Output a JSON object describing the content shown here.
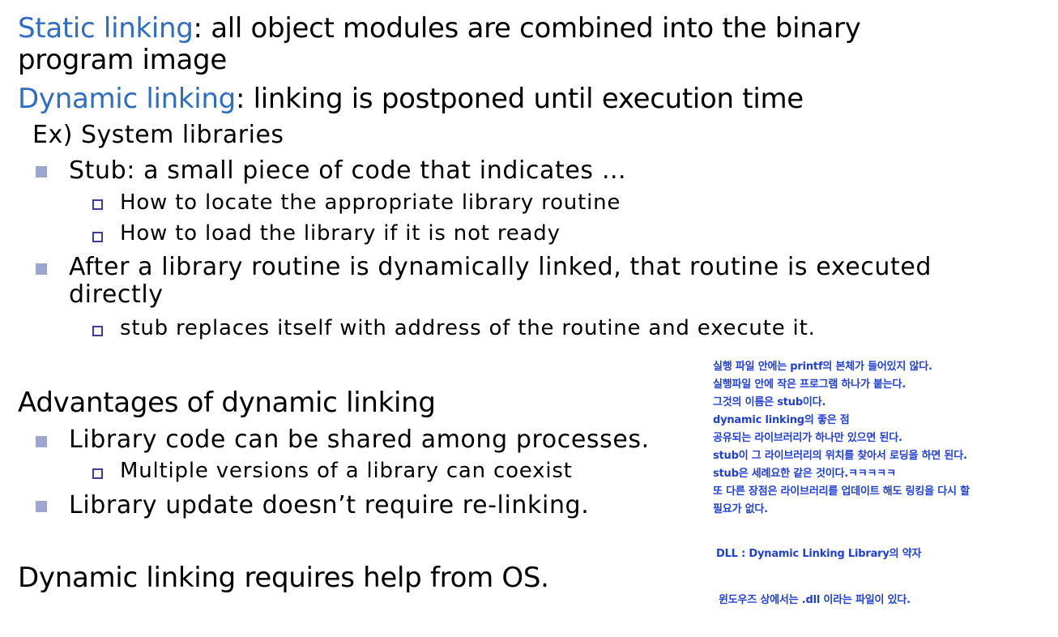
{
  "slide": {
    "static_kw": "Static linking",
    "static_rest": ": all object modules are combined into the binary",
    "static_rest2": "program image",
    "dynamic_kw": "Dynamic linking",
    "dynamic_rest": ": linking is postponed until execution time",
    "example": "Ex) System libraries",
    "stub": "Stub: a small piece of code that indicates …",
    "stub_sub1": "How to locate the appropriate library routine",
    "stub_sub2": "How to load the library if it is not ready",
    "after1": "After a library routine is dynamically linked, that routine is executed",
    "after2": "directly",
    "after_sub": "stub replaces itself with address of the routine and execute it.",
    "adv_heading": "Advantages of dynamic linking",
    "adv1": "Library code can be shared among processes.",
    "adv1_sub": "Multiple versions of a library can coexist",
    "adv2": "Library update doesn’t require re-linking.",
    "os_help": "Dynamic linking requires help from OS."
  },
  "notes": {
    "lines": [
      "실행 파일 안에는 printf의 본체가 들어있지 않다.",
      "실행파일 안에 작은 프로그램 하나가 붙는다.",
      "그것의 이름은 stub이다.",
      "dynamic linking의 좋은 점",
      "공유되는 라이브러리가 하나만 있으면 된다.",
      "stub이 그 라이브러리의 위치를 찾아서 로딩을 하면 된다.",
      "stub은 세례요한 같은 것이다.ㅋㅋㅋㅋㅋ",
      "또 다른 장점은 라이브러리를 업데이트 해도 링킹을 다시 할",
      "필요가 없다."
    ],
    "dll": "DLL : Dynamic Linking Library의 약자",
    "windows": "윈도우즈 상에서는 .dll 이라는 파일이 있다."
  },
  "colors": {
    "keyword": "#2e6dc4",
    "note_text": "#1f3fd8",
    "bullet_fill": "#9ea6cf",
    "sub_bullet_border": "#3a3f9a"
  }
}
